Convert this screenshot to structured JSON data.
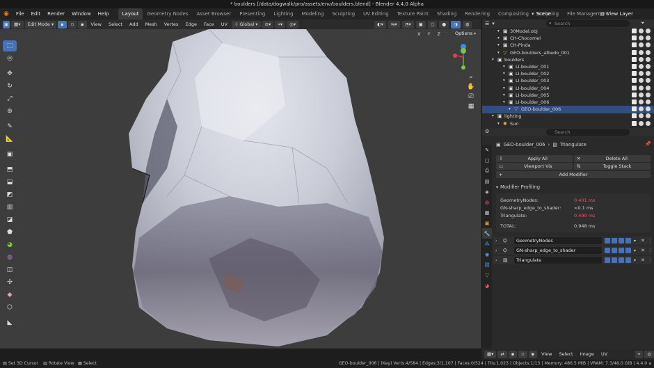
{
  "window": {
    "title": "* boulders [/data/dogwalk/pro/assets/env/boulders.blend] - Blender 4.4.0 Alpha"
  },
  "menubar": {
    "menus": [
      "File",
      "Edit",
      "Render",
      "Window",
      "Help"
    ],
    "workspaces": [
      "Layout",
      "Geometry Nodes",
      "Asset Browser",
      "Presenting",
      "Lighting",
      "Modeling",
      "Sculpting",
      "UV Editing",
      "Texture Paint",
      "Shading",
      "Rendering",
      "Compositing",
      "Scripting",
      "File Management"
    ],
    "active_workspace": "Layout",
    "scene": "Scene",
    "view_layer": "View Layer"
  },
  "viewport_header": {
    "mode": "Edit Mode",
    "menus": [
      "View",
      "Select",
      "Add",
      "Mesh",
      "Vertex",
      "Edge",
      "Face",
      "UV"
    ],
    "transform_orientation": "Global",
    "axes": [
      "X",
      "Y",
      "Z"
    ],
    "options_label": "Options"
  },
  "outliner": {
    "search_placeholder": "Search",
    "rows": [
      {
        "label": "30Model.obj",
        "indent": 2,
        "icon": "collection-icon",
        "selected": false
      },
      {
        "label": "CH-Chocomel",
        "indent": 2,
        "icon": "collection-icon",
        "selected": false
      },
      {
        "label": "CH-Pinda",
        "indent": 2,
        "icon": "collection-icon",
        "selected": false
      },
      {
        "label": "GEO-boulders_albedo_001",
        "indent": 2,
        "icon": "mesh-icon",
        "selected": false
      },
      {
        "label": "boulders",
        "indent": 1,
        "icon": "collection-icon",
        "selected": false
      },
      {
        "label": "LI-boulder_001",
        "indent": 3,
        "icon": "collection-icon",
        "selected": false
      },
      {
        "label": "LI-boulder_002",
        "indent": 3,
        "icon": "collection-icon",
        "selected": false
      },
      {
        "label": "LI-boulder_003",
        "indent": 3,
        "icon": "collection-icon",
        "selected": false
      },
      {
        "label": "LI-boulder_004",
        "indent": 3,
        "icon": "collection-icon",
        "selected": false
      },
      {
        "label": "LI-boulder_005",
        "indent": 3,
        "icon": "collection-icon",
        "selected": false
      },
      {
        "label": "LI-boulder_006",
        "indent": 3,
        "icon": "collection-icon",
        "selected": false
      },
      {
        "label": "GEO-boulder_006",
        "indent": 4,
        "icon": "mesh-icon",
        "selected": true
      },
      {
        "label": "lighting",
        "indent": 1,
        "icon": "collection-icon",
        "selected": false
      },
      {
        "label": "Sun",
        "indent": 2,
        "icon": "light-icon",
        "selected": false
      }
    ]
  },
  "properties": {
    "search_placeholder": "Search",
    "object_name": "GEO-boulder_006",
    "breadcrumb_modifier": "Triangulate",
    "apply_all": "Apply All",
    "delete_all": "Delete All",
    "viewport_vis": "Viewport Vis",
    "toggle_stack": "Toggle Stack",
    "add_modifier": "Add Modifier",
    "profiling_title": "Modifier Profiling",
    "profiling": [
      {
        "label": "GeometryNodes:",
        "value": "0.401 ms",
        "hot": true
      },
      {
        "label": "GN-sharp_edge_to_shader:",
        "value": "<0.1 ms",
        "hot": false
      },
      {
        "label": "Triangulate:",
        "value": "0.499 ms",
        "hot": true
      }
    ],
    "total_label": "TOTAL:",
    "total_value": "0.948 ms",
    "modifiers": [
      "GeometryNodes",
      "GN-sharp_edge_to_shader",
      "Triangulate"
    ],
    "hot_color": "#e0586a"
  },
  "uv_header": {
    "menus": [
      "View",
      "Select",
      "Image",
      "UV"
    ]
  },
  "statusbar": {
    "left": [
      {
        "icon": "mouse-left-icon",
        "label": "Set 3D Cursor"
      },
      {
        "icon": "mouse-middle-icon",
        "label": "Rotate View"
      },
      {
        "icon": "mouse-right-icon",
        "label": "Select"
      }
    ],
    "right": "GEO-boulder_006 | (Key) Verts:4/584 | Edges:3/1,107 | Faces:0/524 | Tris:1,023 | Objects:1/13 | Memory: 486.5 MiB | VRAM: 7.3/48.0 GiB | 4.4.0 a"
  },
  "colors": {
    "accent": "#4772b3",
    "gizmo_x": "#e0405a",
    "gizmo_y": "#7ec63a",
    "gizmo_z": "#3b8ee8"
  }
}
